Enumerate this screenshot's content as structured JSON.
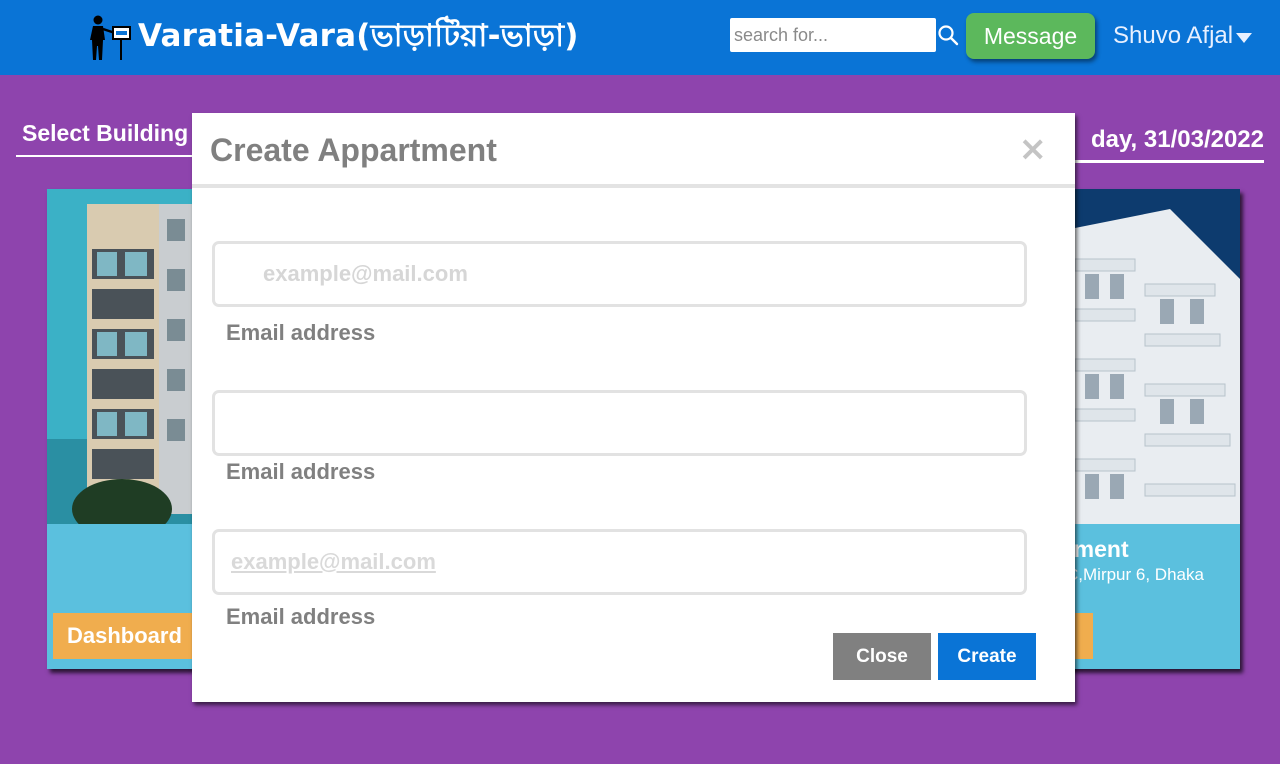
{
  "header": {
    "brand": "Varatia-Vara(ভাড়াটিয়া-ভাড়া)",
    "logo_icon": "person-with-rent-sign-icon",
    "search_placeholder": "search for...",
    "search_icon": "search-icon",
    "message_label": "Message",
    "user_name": "Shuvo Afjal",
    "user_menu_icon": "caret-down-icon"
  },
  "page": {
    "select_building_label": "Select Building",
    "date_label": "day, 31/03/2022",
    "cards": [
      {
        "dashboard_label": "Dashboard"
      },
      {
        "title": "tment",
        "address": "C,Mirpur 6, Dhaka"
      }
    ]
  },
  "modal": {
    "title": "Create Appartment",
    "close_icon": "close-icon",
    "fields": [
      {
        "placeholder": "example@mail.com",
        "value": "",
        "label": "Email address"
      },
      {
        "placeholder": "",
        "value": "",
        "label": "Email address"
      },
      {
        "placeholder": "example@mail.com",
        "value": "",
        "label": "Email address"
      }
    ],
    "close_button": "Close",
    "create_button": "Create"
  },
  "colors": {
    "navbar": "#0a74d6",
    "background": "#8e44ad",
    "message_button": "#5cb85c",
    "card": "#5bc0de",
    "dashboard_button": "#f0ad4e",
    "close_button": "#808080",
    "create_button": "#0a74d6"
  }
}
